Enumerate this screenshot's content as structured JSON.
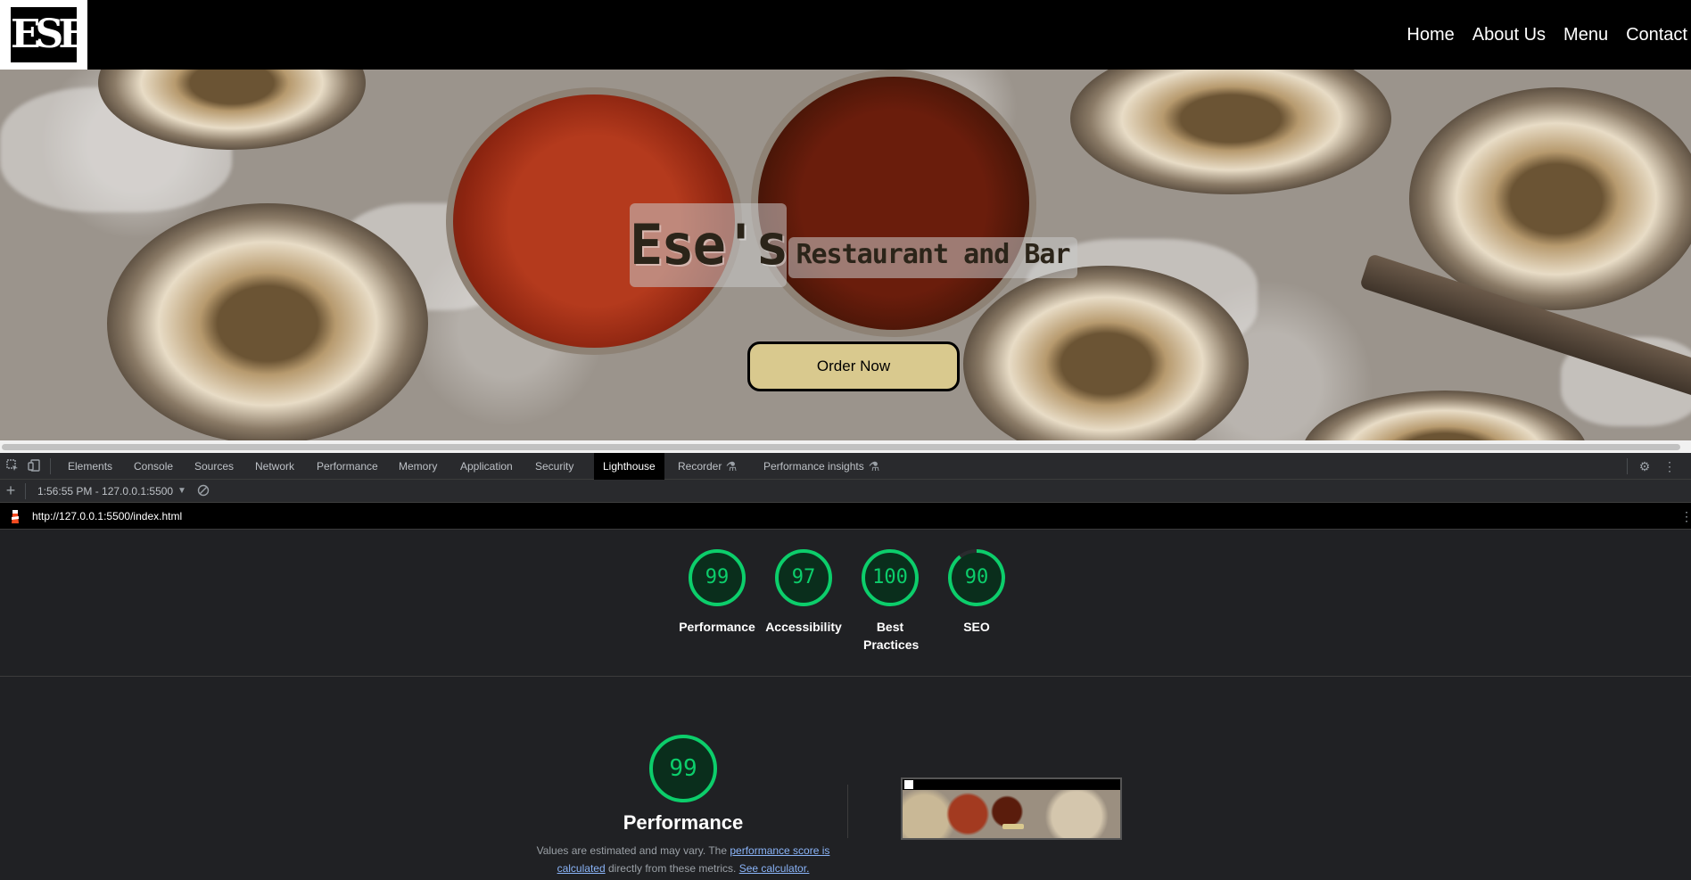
{
  "site": {
    "logo_text": "ESE",
    "nav": [
      "Home",
      "About Us",
      "Menu",
      "Contact"
    ],
    "hero_title": "Ese's",
    "hero_subtitle": "Restaurant and Bar",
    "order_button": "Order Now"
  },
  "devtools": {
    "tabs": [
      "Elements",
      "Console",
      "Sources",
      "Network",
      "Performance",
      "Memory",
      "Application",
      "Security",
      "Lighthouse",
      "Recorder",
      "Performance insights"
    ],
    "active_tab": "Lighthouse",
    "report_selector": "1:56:55 PM - 127.0.0.1:5500",
    "url": "http://127.0.0.1:5500/index.html",
    "scores": [
      {
        "label": "Performance",
        "value": "99"
      },
      {
        "label": "Accessibility",
        "value": "97"
      },
      {
        "label": "Best Practices",
        "value": "100"
      },
      {
        "label": "SEO",
        "value": "90"
      }
    ],
    "score_color": "#0cce6b",
    "performance": {
      "score": "99",
      "title": "Performance",
      "desc_prefix": "Values are estimated and may vary. The ",
      "desc_link1": "performance score is calculated",
      "desc_middle": " directly from these metrics. ",
      "desc_link2": "See calculator."
    }
  }
}
